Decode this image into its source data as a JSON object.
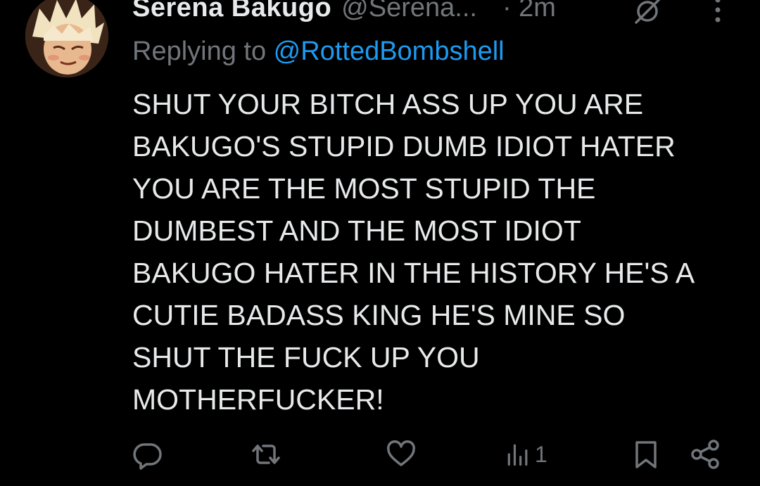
{
  "tweet": {
    "display_name": "Serena Bakugo",
    "handle": "@Serena...",
    "time": "· 2m",
    "replying_prefix": "Replying to ",
    "replying_to": "@RottedBombshell",
    "body_lines": [
      "SHUT YOUR BITCH ASS UP YOU ARE",
      "BAKUGO'S STUPID DUMB IDIOT HATER",
      "YOU ARE THE MOST STUPID THE",
      "DUMBEST AND THE MOST IDIOT",
      "BAKUGO HATER IN THE HISTORY HE'S A",
      "CUTIE BADASS KING HE'S MINE SO",
      "SHUT THE FUCK UP YOU",
      "MOTHERFUCKER!"
    ]
  },
  "actions": {
    "views_count": "1"
  },
  "icons": {
    "avatar": "avatar-photo",
    "grok": "grok-icon",
    "more": "more-options-icon",
    "reply": "reply-icon",
    "retweet": "retweet-icon",
    "like": "like-icon",
    "views": "views-icon",
    "bookmark": "bookmark-icon",
    "share": "share-icon"
  },
  "colors": {
    "background": "#000000",
    "text": "#e7e9ea",
    "muted": "#71767b",
    "link": "#1d9bf0"
  }
}
